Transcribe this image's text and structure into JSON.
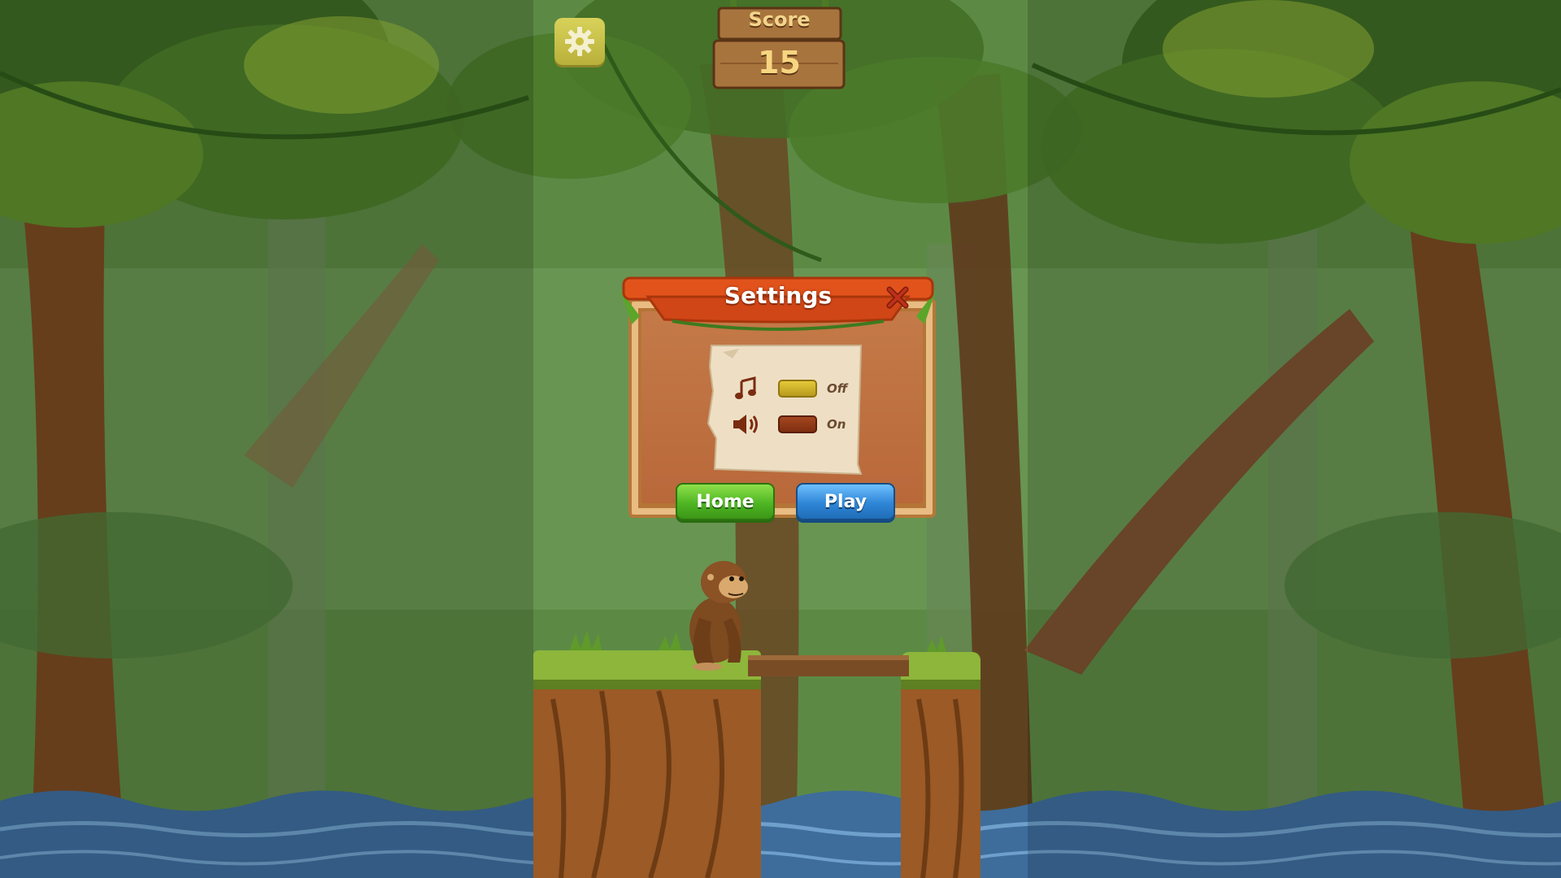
{
  "hud": {
    "settings_icon": "gear-icon",
    "score_label": "Score",
    "score_value": "15"
  },
  "dialog": {
    "title": "Settings",
    "close_icon": "close-icon",
    "music": {
      "icon": "music-note-icon",
      "state_label": "Off"
    },
    "sound": {
      "icon": "speaker-icon",
      "state_label": "On"
    },
    "home_label": "Home",
    "play_label": "Play"
  },
  "colors": {
    "header_orange": "#e2531c",
    "home_green": "#4fb623",
    "play_blue": "#2f86d6",
    "toggle_off": "#d4b82e",
    "toggle_on": "#8e3615"
  }
}
